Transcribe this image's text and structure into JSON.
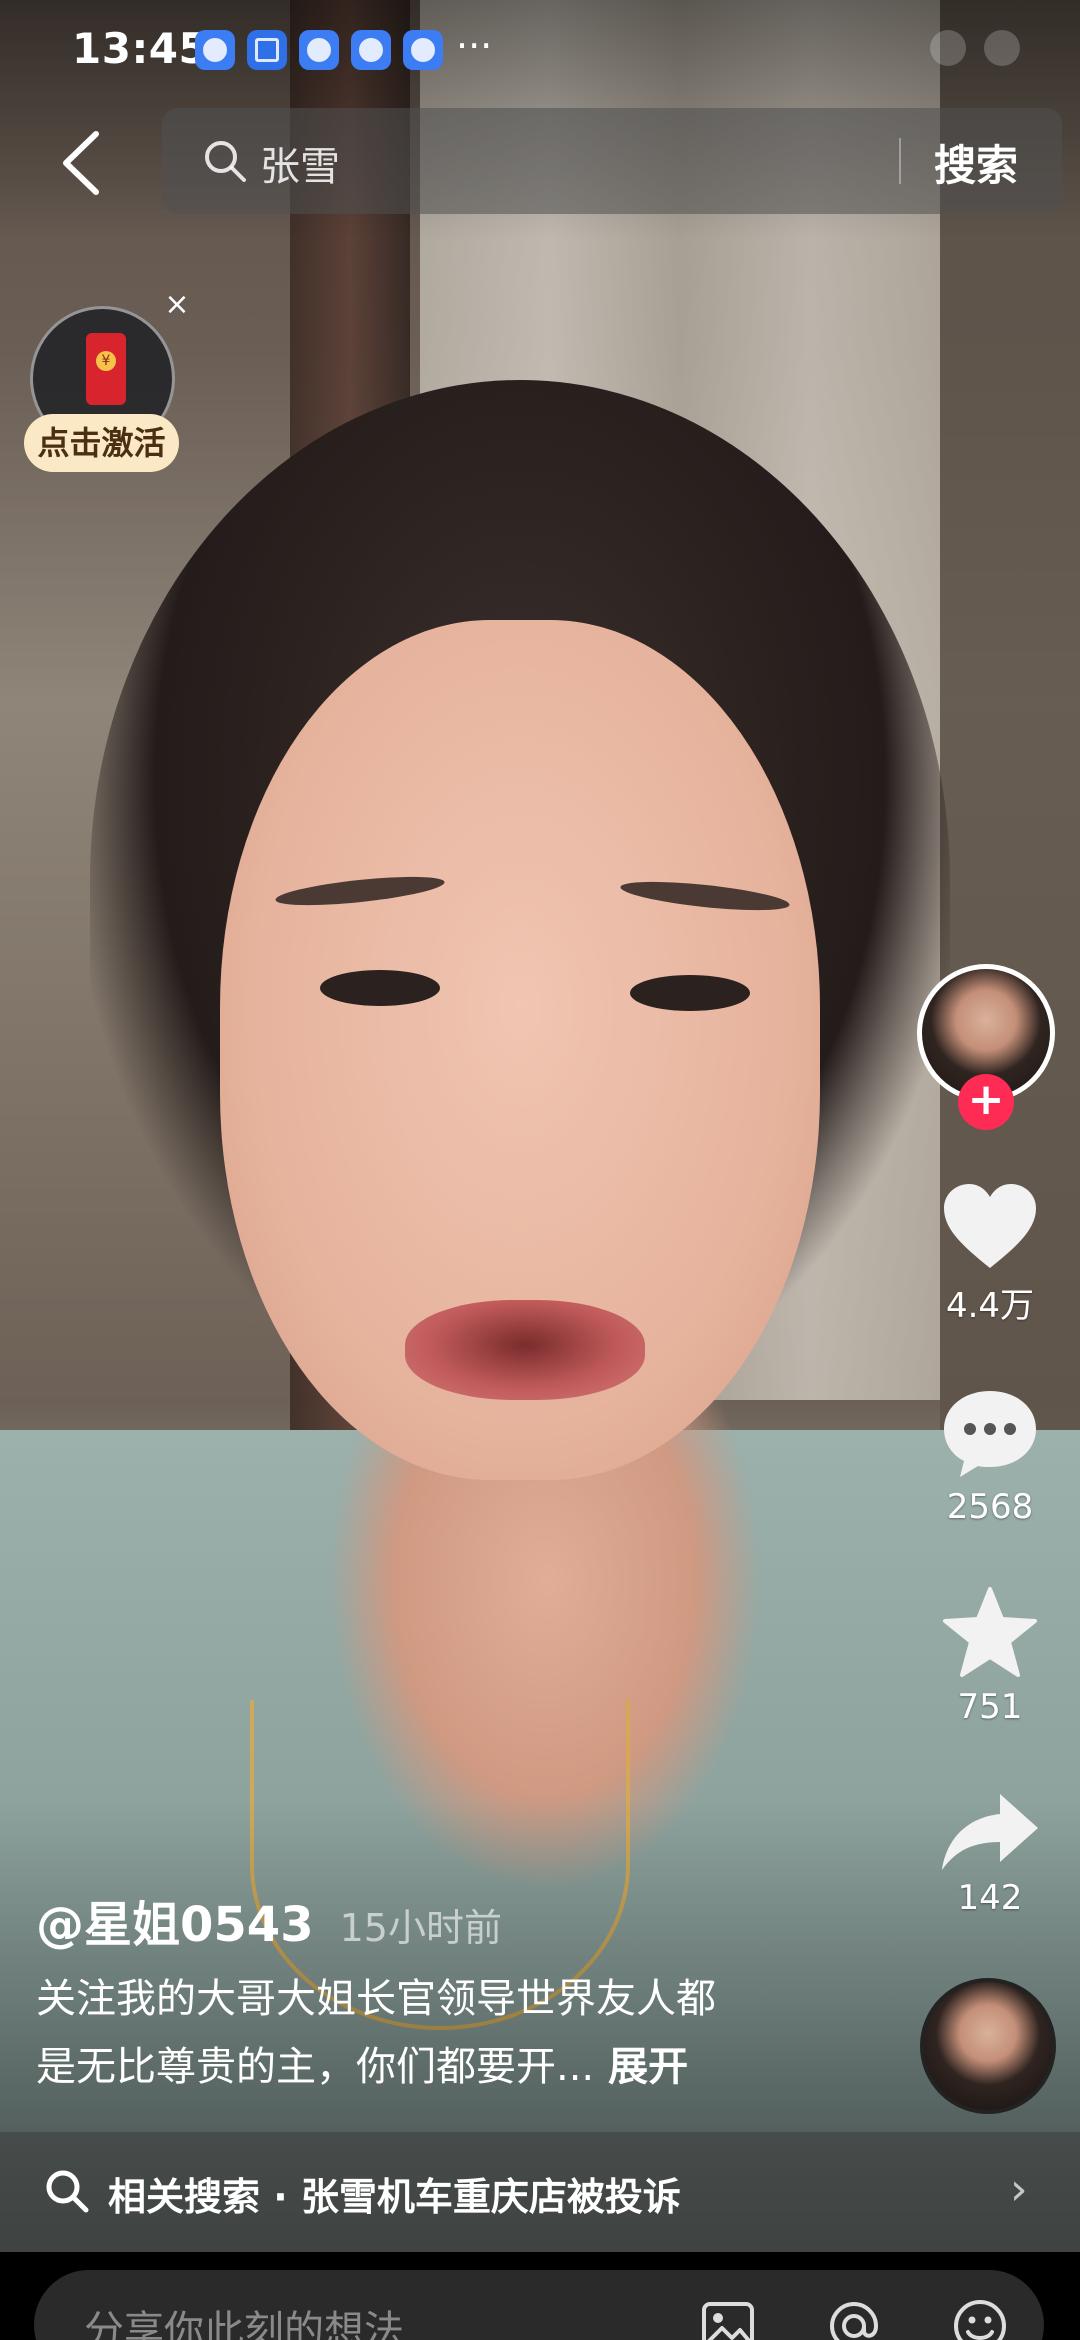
{
  "status_bar": {
    "time": "13:45",
    "more": "···",
    "app_icons": [
      "app-icon",
      "app-icon",
      "app-icon",
      "app-icon",
      "app-icon"
    ]
  },
  "search": {
    "query": "张雪",
    "button_label": "搜索"
  },
  "red_packet": {
    "label": "点击激活",
    "close": "×"
  },
  "actions": {
    "follow": "+",
    "likes": "4.4万",
    "comments": "2568",
    "favorites": "751",
    "shares": "142"
  },
  "post": {
    "author": "@星姐0543",
    "time": "15小时前",
    "caption_line1": "关注我的大哥大姐长官领导世界友人都",
    "caption_line2": "是无比尊贵的主，你们都要开...",
    "expand_label": "展开"
  },
  "related_search": {
    "text": "相关搜索 · 张雪机车重庆店被投诉",
    "chevron": "›"
  },
  "comment_bar": {
    "placeholder": "分享你此刻的想法"
  },
  "colors": {
    "follow_red": "#fe2c55",
    "packet_label_bg": "#fbe9c5"
  }
}
